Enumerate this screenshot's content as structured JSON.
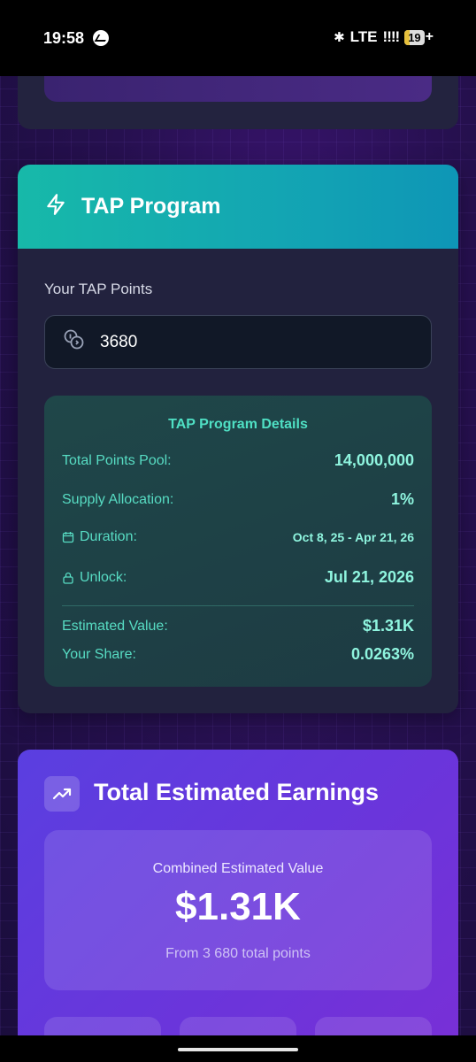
{
  "status_bar": {
    "time": "19:58",
    "network": "LTE",
    "signal": "!!!!",
    "battery": "19",
    "battery_suffix": "+"
  },
  "tap": {
    "title": "TAP Program",
    "icon": "lightning-icon",
    "points_label": "Your TAP Points",
    "points_value": "3680",
    "details": {
      "title": "TAP Program Details",
      "rows": [
        {
          "label": "Total Points Pool:",
          "value": "14,000,000"
        },
        {
          "label": "Supply Allocation:",
          "value": "1%"
        },
        {
          "label": "Duration:",
          "value": "Oct 8, 25 - Apr 21, 26"
        },
        {
          "label": "Unlock:",
          "value": "Jul 21, 2026"
        },
        {
          "label": "Estimated Value:",
          "value": "$1.31K"
        },
        {
          "label": "Your Share:",
          "value": "0.0263%"
        }
      ]
    }
  },
  "earnings": {
    "title": "Total Estimated Earnings",
    "icon": "trending-up-icon",
    "combined_label": "Combined Estimated Value",
    "combined_value": "$1.31K",
    "from_text": "From 3 680 total points"
  },
  "colors": {
    "tap_header": "#17b9a9",
    "details_text": "#57dcc3",
    "earnings_bg": "#6a35db"
  }
}
